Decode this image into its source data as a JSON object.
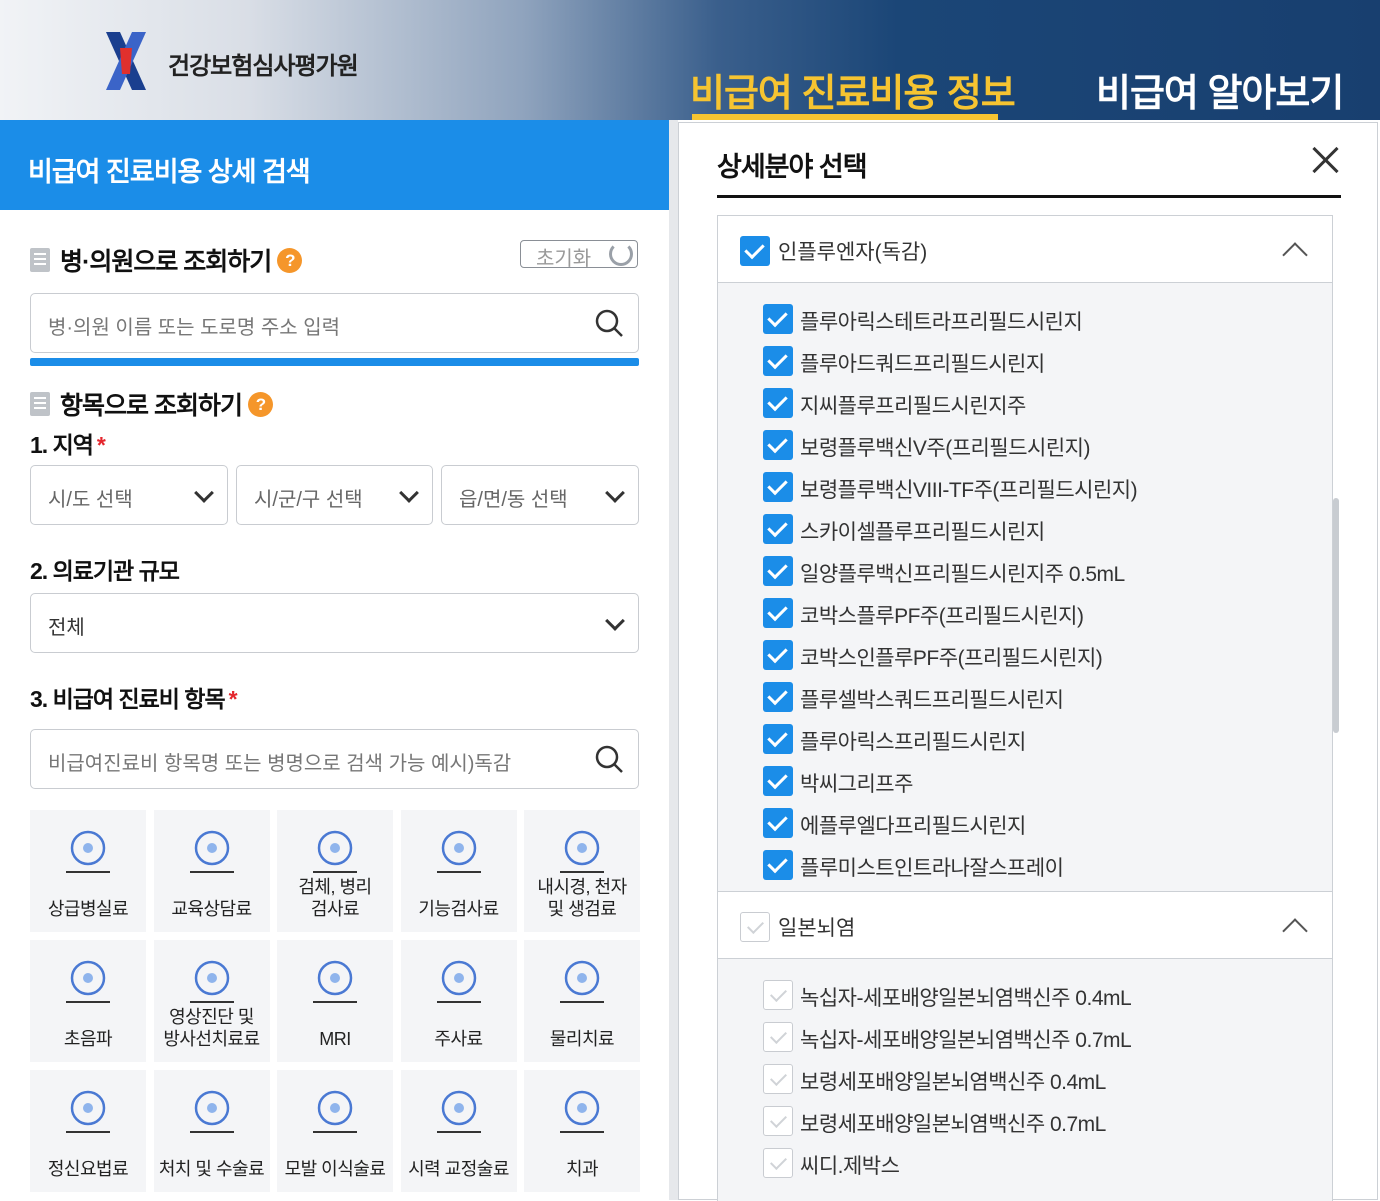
{
  "header": {
    "brand": "건강보험심사평가원",
    "nav_active": "비급여 진료비용 정보",
    "nav_other": "비급여 알아보기"
  },
  "left": {
    "title": "비급여 진료비용 상세 검색",
    "hospital_section": "병·의원으로 조회하기",
    "reset_label": "초기화",
    "hospital_placeholder": "병·의원 이름 또는 도로명 주소 입력",
    "item_section": "항목으로 조회하기",
    "region_label": "1. 지역",
    "region_selects": [
      "시/도 선택",
      "시/군/구 선택",
      "읍/면/동 선택"
    ],
    "scale_label": "2. 의료기관 규모",
    "scale_value": "전체",
    "category_label": "3. 비급여 진료비 항목",
    "category_placeholder": "비급여진료비 항목명 또는 병명으로 검색 가능 예시)독감",
    "required_mark": "*",
    "help_mark": "?",
    "categories": [
      {
        "line1": "",
        "line2": "상급병실료",
        "icon": "bed-icon"
      },
      {
        "line1": "",
        "line2": "교육상담료",
        "icon": "counseling-icon"
      },
      {
        "line1": "검체, 병리",
        "line2": "검사료",
        "icon": "specimen-icon"
      },
      {
        "line1": "",
        "line2": "기능검사료",
        "icon": "function-test-icon"
      },
      {
        "line1": "내시경, 천자",
        "line2": "및 생검료",
        "icon": "endoscope-icon"
      },
      {
        "line1": "",
        "line2": "초음파",
        "icon": "ultrasound-icon"
      },
      {
        "line1": "영상진단 및",
        "line2": "방사선치료료",
        "icon": "imaging-icon"
      },
      {
        "line1": "",
        "line2": "MRI",
        "icon": "mri-icon"
      },
      {
        "line1": "",
        "line2": "주사료",
        "icon": "injection-icon"
      },
      {
        "line1": "",
        "line2": "물리치료",
        "icon": "physical-therapy-icon"
      },
      {
        "line1": "",
        "line2": "정신요법료",
        "icon": "psychotherapy-icon"
      },
      {
        "line1": "",
        "line2": "처치 및 수술료",
        "icon": "surgery-icon"
      },
      {
        "line1": "",
        "line2": "모발 이식술료",
        "icon": "hair-transplant-icon"
      },
      {
        "line1": "",
        "line2": "시력 교정술료",
        "icon": "eye-icon"
      },
      {
        "line1": "",
        "line2": "치과",
        "icon": "tooth-icon"
      }
    ]
  },
  "right": {
    "title": "상세분야 선택",
    "groups": [
      {
        "label": "인플루엔자(독감)",
        "checked": true,
        "items": [
          "플루아릭스테트라프리필드시린지",
          "플루아드쿼드프리필드시린지",
          "지씨플루프리필드시린지주",
          "보령플루백신V주(프리필드시린지)",
          "보령플루백신VIII-TF주(프리필드시린지)",
          "스카이셀플루프리필드시린지",
          "일양플루백신프리필드시린지주 0.5mL",
          "코박스플루PF주(프리필드시린지)",
          "코박스인플루PF주(프리필드시린지)",
          "플루셀박스쿼드프리필드시린지",
          "플루아릭스프리필드시린지",
          "박씨그리프주",
          "에플루엘다프리필드시린지",
          "플루미스트인트라나잘스프레이"
        ]
      },
      {
        "label": "일본뇌염",
        "checked": false,
        "items": [
          "녹십자-세포배양일본뇌염백신주 0.4mL",
          "녹십자-세포배양일본뇌염백신주 0.7mL",
          "보령세포배양일본뇌염백신주 0.4mL",
          "보령세포배양일본뇌염백신주 0.7mL",
          "씨디.제박스"
        ]
      }
    ]
  },
  "colors": {
    "primary": "#1b8de8",
    "accent": "#f6c431",
    "help": "#f5962a",
    "required": "#e4262d"
  }
}
